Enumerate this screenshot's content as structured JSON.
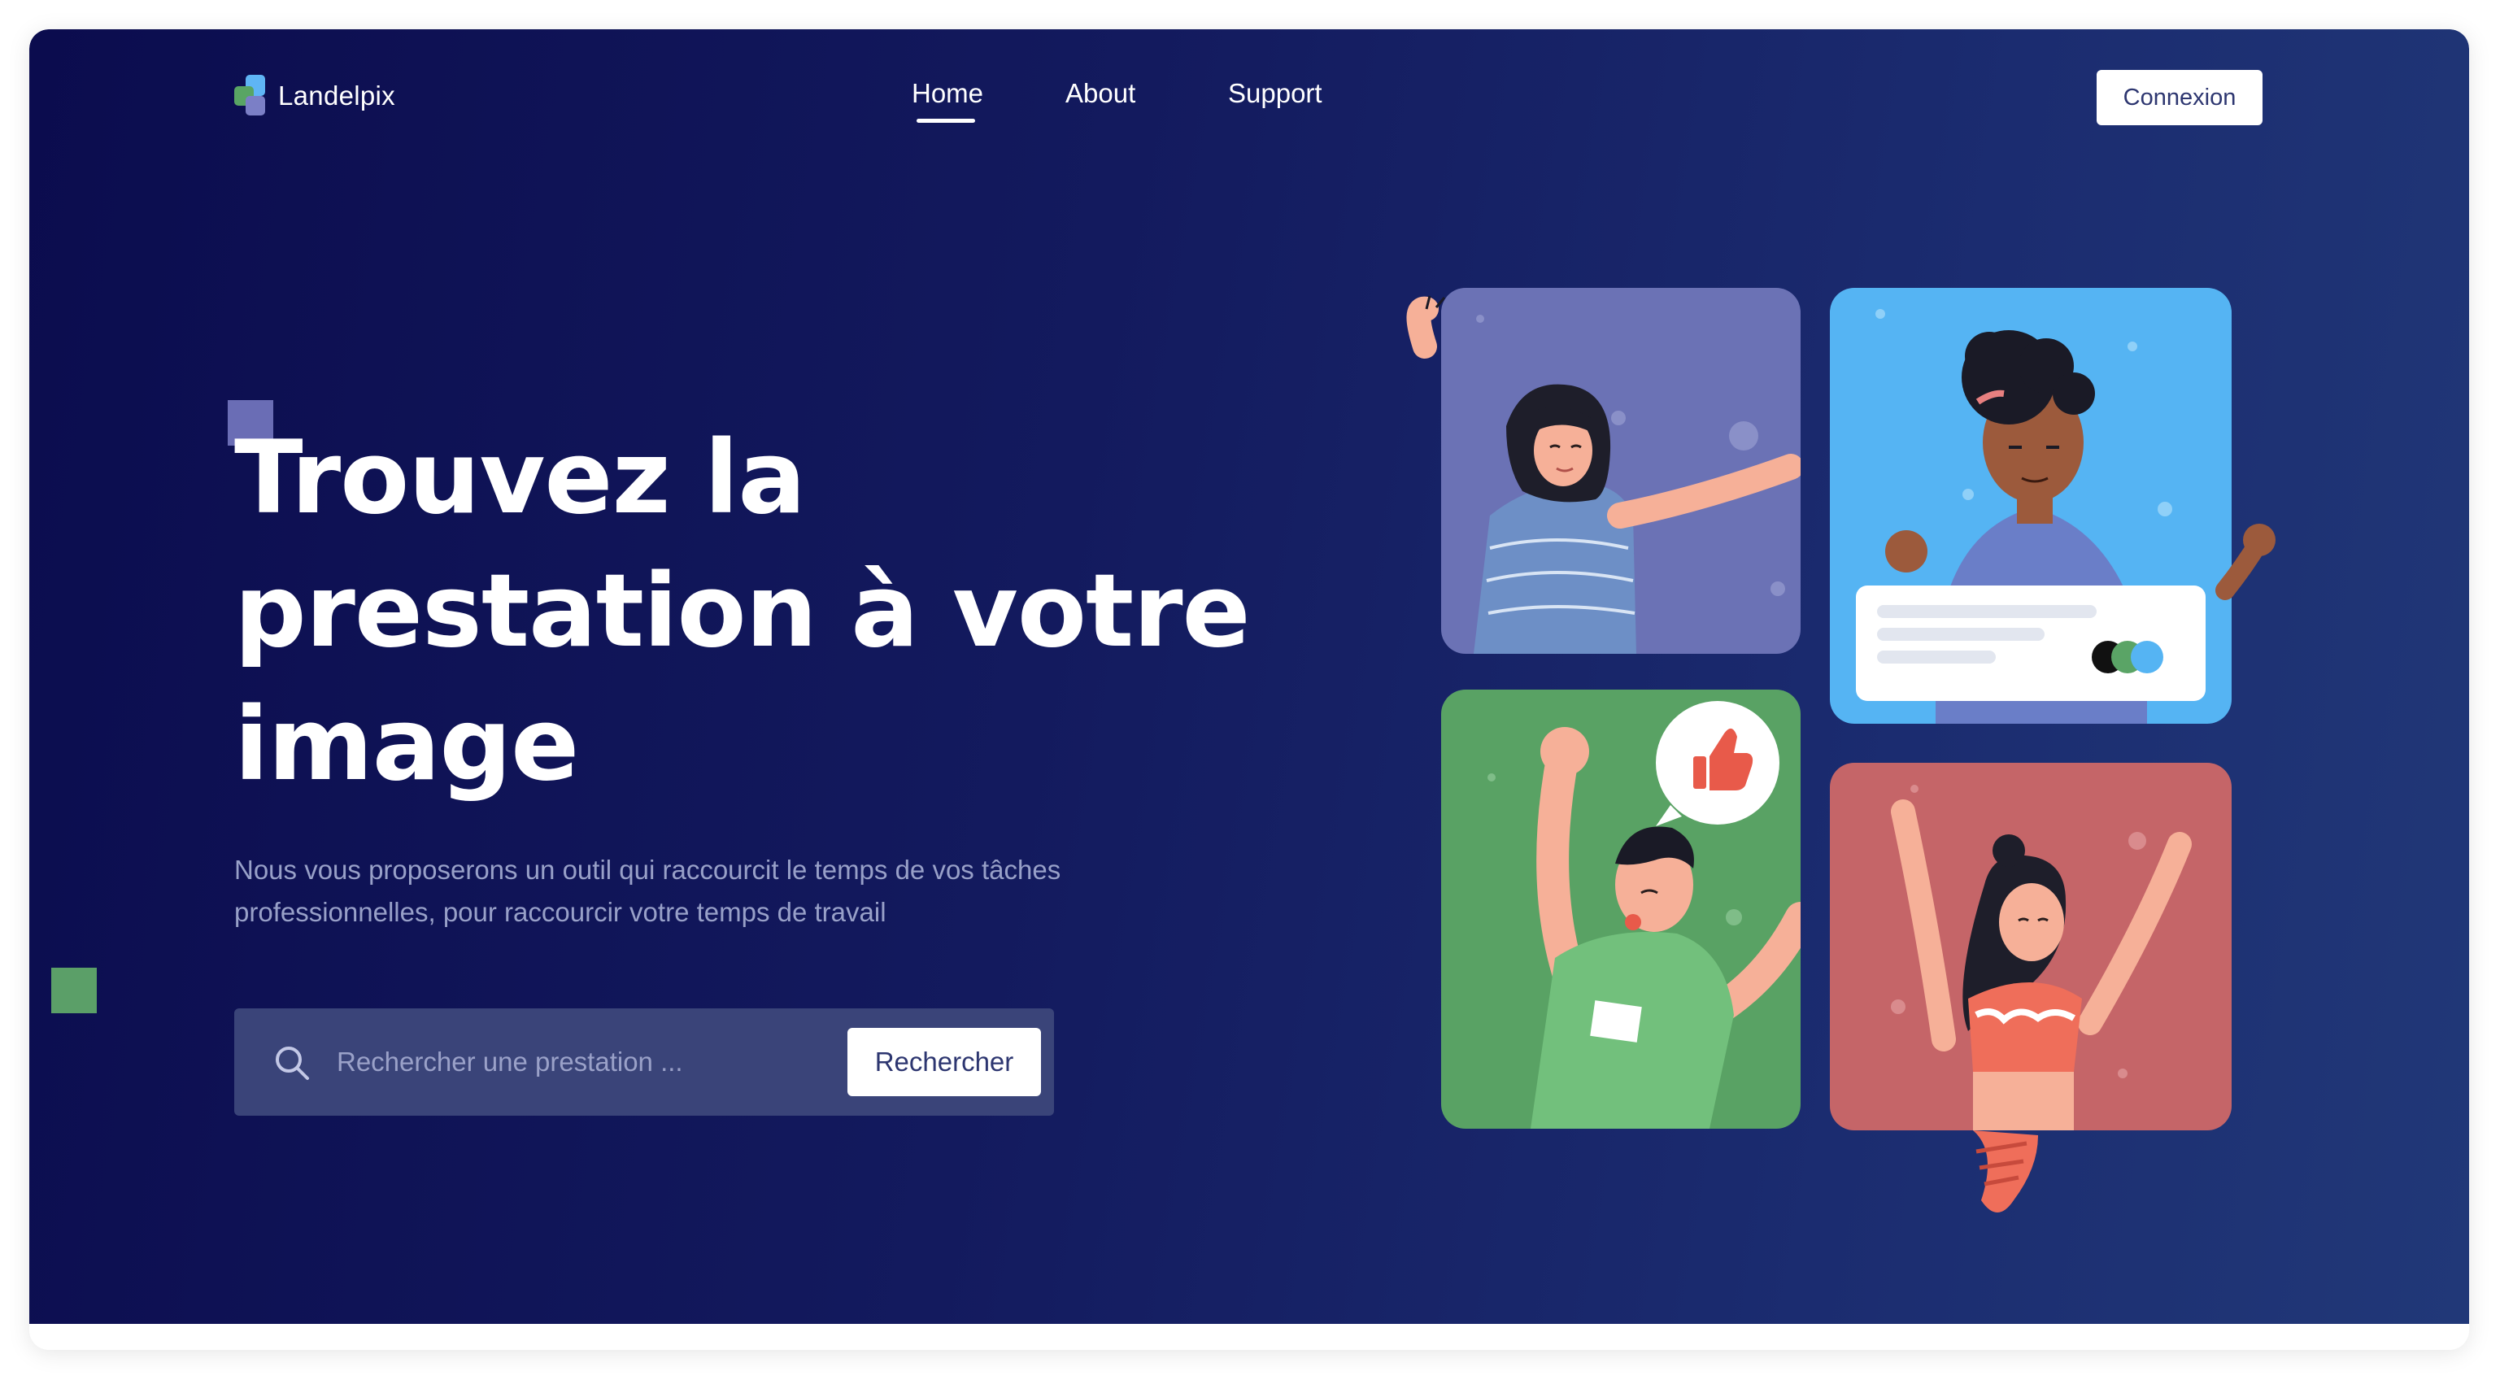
{
  "brand": {
    "name": "Landelpix"
  },
  "nav": {
    "items": [
      {
        "label": "Home",
        "active": true
      },
      {
        "label": "About",
        "active": false
      },
      {
        "label": "Support",
        "active": false
      }
    ],
    "login_label": "Connexion"
  },
  "hero": {
    "headline": "Trouvez la prestation à votre image",
    "subtitle": "Nous vous proposerons un outil qui raccourcit le temps de vos tâches professionnelles, pour raccourcir votre temps de travail"
  },
  "search": {
    "placeholder": "Rechercher une prestation ...",
    "button_label": "Rechercher"
  },
  "colors": {
    "background_start": "#0b0c4e",
    "background_end": "#213878",
    "card_purple": "#6b72b5",
    "card_blue": "#55b4f3",
    "card_green": "#59a264",
    "card_red": "#c56568",
    "accent_thumb": "#e85a4a"
  },
  "icons": [
    "logo-mark-icon",
    "search-icon",
    "thumbs-up-icon"
  ]
}
